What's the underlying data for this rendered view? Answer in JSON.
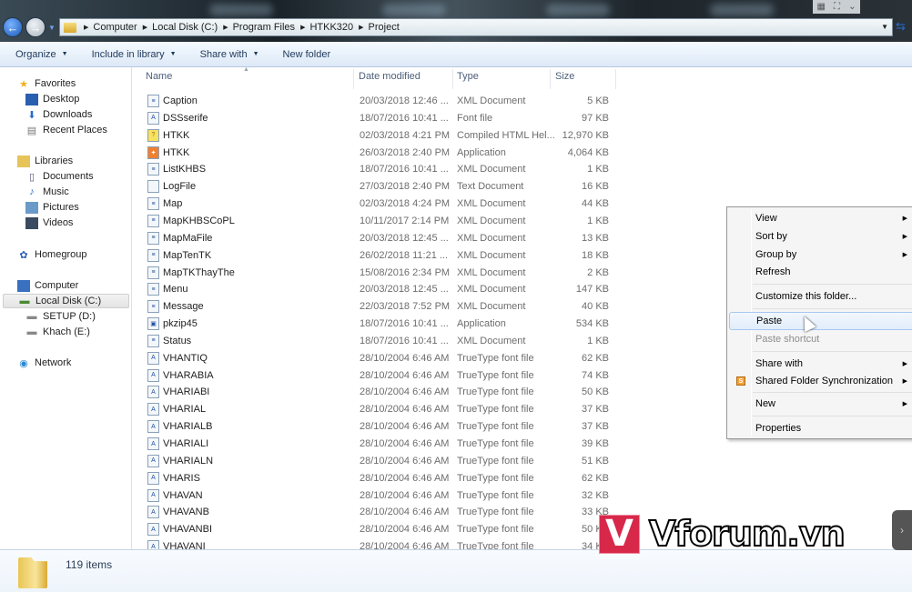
{
  "address_bar": {
    "crumbs": [
      "Computer",
      "Local Disk (C:)",
      "Program Files",
      "HTKK320",
      "Project"
    ]
  },
  "toolbar": {
    "organize": "Organize",
    "include_in_library": "Include in library",
    "share_with": "Share with",
    "new_folder": "New folder"
  },
  "nav": {
    "favorites": "Favorites",
    "desktop": "Desktop",
    "downloads": "Downloads",
    "recent_places": "Recent Places",
    "libraries": "Libraries",
    "documents": "Documents",
    "music": "Music",
    "pictures": "Pictures",
    "videos": "Videos",
    "homegroup": "Homegroup",
    "computer": "Computer",
    "local_disk": "Local Disk (C:)",
    "setup": "SETUP (D:)",
    "khach": "Khach (E:)",
    "network": "Network"
  },
  "columns": {
    "name": "Name",
    "date": "Date modified",
    "type": "Type",
    "size": "Size"
  },
  "files": [
    {
      "name": "Caption",
      "date": "20/03/2018 12:46 ...",
      "type": "XML Document",
      "size": "5 KB",
      "icon": "xml"
    },
    {
      "name": "DSSserife",
      "date": "18/07/2016 10:41 ...",
      "type": "Font file",
      "size": "97 KB",
      "icon": "font"
    },
    {
      "name": "HTKK",
      "date": "02/03/2018 4:21 PM",
      "type": "Compiled HTML Hel...",
      "size": "12,970 KB",
      "icon": "help"
    },
    {
      "name": "HTKK",
      "date": "26/03/2018 2:40 PM",
      "type": "Application",
      "size": "4,064 KB",
      "icon": "app-htkk"
    },
    {
      "name": "ListKHBS",
      "date": "18/07/2016 10:41 ...",
      "type": "XML Document",
      "size": "1 KB",
      "icon": "xml"
    },
    {
      "name": "LogFile",
      "date": "27/03/2018 2:40 PM",
      "type": "Text Document",
      "size": "16 KB",
      "icon": "text"
    },
    {
      "name": "Map",
      "date": "02/03/2018 4:24 PM",
      "type": "XML Document",
      "size": "44 KB",
      "icon": "xml"
    },
    {
      "name": "MapKHBSCoPL",
      "date": "10/11/2017 2:14 PM",
      "type": "XML Document",
      "size": "1 KB",
      "icon": "xml"
    },
    {
      "name": "MapMaFile",
      "date": "20/03/2018 12:45 ...",
      "type": "XML Document",
      "size": "13 KB",
      "icon": "xml"
    },
    {
      "name": "MapTenTK",
      "date": "26/02/2018 11:21 ...",
      "type": "XML Document",
      "size": "18 KB",
      "icon": "xml"
    },
    {
      "name": "MapTKThayThe",
      "date": "15/08/2016 2:34 PM",
      "type": "XML Document",
      "size": "2 KB",
      "icon": "xml"
    },
    {
      "name": "Menu",
      "date": "20/03/2018 12:45 ...",
      "type": "XML Document",
      "size": "147 KB",
      "icon": "xml"
    },
    {
      "name": "Message",
      "date": "22/03/2018 7:52 PM",
      "type": "XML Document",
      "size": "40 KB",
      "icon": "xml"
    },
    {
      "name": "pkzip45",
      "date": "18/07/2016 10:41 ...",
      "type": "Application",
      "size": "534 KB",
      "icon": "app"
    },
    {
      "name": "Status",
      "date": "18/07/2016 10:41 ...",
      "type": "XML Document",
      "size": "1 KB",
      "icon": "xml"
    },
    {
      "name": "VHANTIQ",
      "date": "28/10/2004 6:46 AM",
      "type": "TrueType font file",
      "size": "62 KB",
      "icon": "font"
    },
    {
      "name": "VHARABIA",
      "date": "28/10/2004 6:46 AM",
      "type": "TrueType font file",
      "size": "74 KB",
      "icon": "font"
    },
    {
      "name": "VHARIABI",
      "date": "28/10/2004 6:46 AM",
      "type": "TrueType font file",
      "size": "50 KB",
      "icon": "font"
    },
    {
      "name": "VHARIAL",
      "date": "28/10/2004 6:46 AM",
      "type": "TrueType font file",
      "size": "37 KB",
      "icon": "font"
    },
    {
      "name": "VHARIALB",
      "date": "28/10/2004 6:46 AM",
      "type": "TrueType font file",
      "size": "37 KB",
      "icon": "font"
    },
    {
      "name": "VHARIALI",
      "date": "28/10/2004 6:46 AM",
      "type": "TrueType font file",
      "size": "39 KB",
      "icon": "font"
    },
    {
      "name": "VHARIALN",
      "date": "28/10/2004 6:46 AM",
      "type": "TrueType font file",
      "size": "51 KB",
      "icon": "font"
    },
    {
      "name": "VHARIS",
      "date": "28/10/2004 6:46 AM",
      "type": "TrueType font file",
      "size": "62 KB",
      "icon": "font"
    },
    {
      "name": "VHAVAN",
      "date": "28/10/2004 6:46 AM",
      "type": "TrueType font file",
      "size": "32 KB",
      "icon": "font"
    },
    {
      "name": "VHAVANB",
      "date": "28/10/2004 6:46 AM",
      "type": "TrueType font file",
      "size": "33 KB",
      "icon": "font"
    },
    {
      "name": "VHAVANBI",
      "date": "28/10/2004 6:46 AM",
      "type": "TrueType font file",
      "size": "50 KB",
      "icon": "font"
    },
    {
      "name": "VHAVANI",
      "date": "28/10/2004 6:46 AM",
      "type": "TrueType font file",
      "size": "34 KB",
      "icon": "font"
    }
  ],
  "status": {
    "item_count": "119 items"
  },
  "context_menu": {
    "view": "View",
    "sort_by": "Sort by",
    "group_by": "Group by",
    "refresh": "Refresh",
    "customize": "Customize this folder...",
    "paste": "Paste",
    "paste_shortcut": "Paste shortcut",
    "share_with": "Share with",
    "shared_folder_sync": "Shared Folder Synchronization",
    "new": "New",
    "properties": "Properties"
  },
  "watermark": {
    "text": "Vforum.vn"
  },
  "colors": {
    "highlight": "#e1edfb",
    "toolbar": "#dde9f7",
    "watermark_red": "#d8284a"
  }
}
